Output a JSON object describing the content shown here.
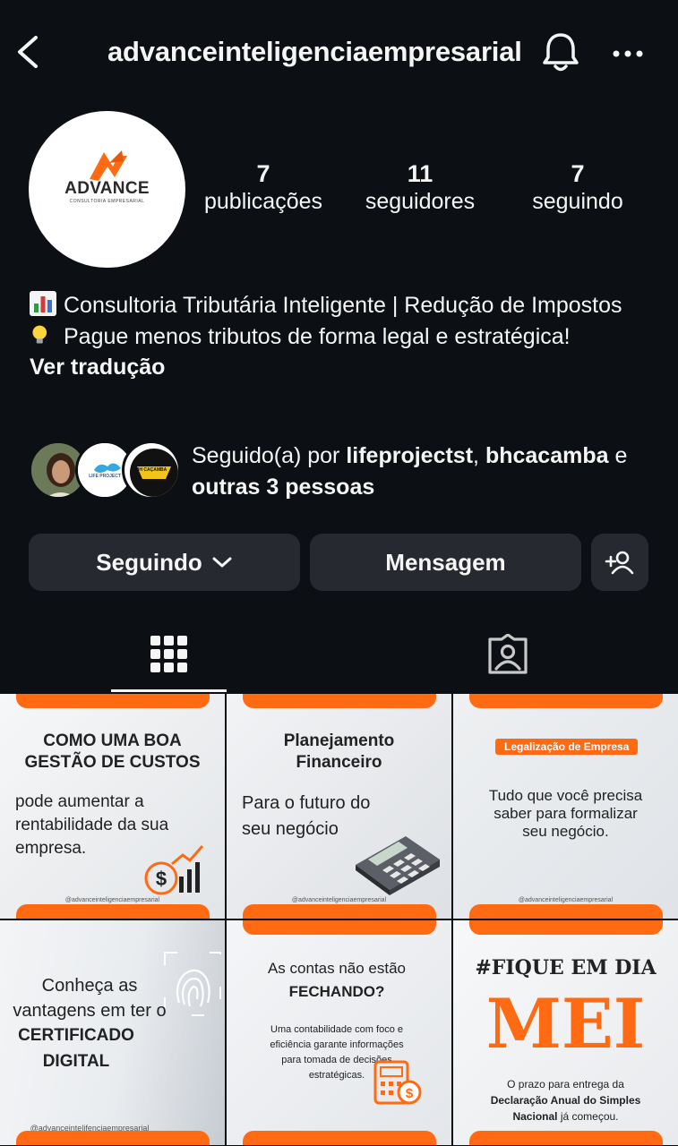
{
  "header": {
    "username": "advanceinteligenciaempresarial"
  },
  "profile": {
    "avatar_brand": "ADVANCE",
    "avatar_tagline": "CONSULTORIA EMPRESARIAL",
    "stats": [
      {
        "value": "7",
        "label": "publicações"
      },
      {
        "value": "11",
        "label": "seguidores"
      },
      {
        "value": "7",
        "label": "seguindo"
      }
    ],
    "bio_line1": "Consultoria Tributária Inteligente | Redução de Impostos",
    "bio_line2": "Pague menos tributos de forma legal e estratégica!",
    "translate_link": "Ver tradução",
    "followed_prefix": "Seguido(a) por ",
    "followed_user1": "lifeprojectst",
    "followed_sep": ", ",
    "followed_user2": "bhcacamba",
    "followed_and": " e ",
    "followed_others": "outras 3 pessoas",
    "follower_avatar2_text": "LIFE PROJECT",
    "follower_avatar3_text": "BH CAÇAMBA"
  },
  "actions": {
    "following_label": "Seguindo",
    "message_label": "Mensagem"
  },
  "posts": [
    {
      "title1": "COMO UMA BOA",
      "title2": "GESTÃO DE CUSTOS",
      "body1": "pode aumentar a",
      "body2": "rentabilidade da sua",
      "body3": "empresa.",
      "handle": "@advanceinteligenciaempresarial"
    },
    {
      "title1": "Planejamento",
      "title2": "Financeiro",
      "body1": "Para o futuro do",
      "body2": "seu negócio",
      "handle": "@advanceinteligenciaempresarial"
    },
    {
      "tag": "Legalização de Empresa",
      "body1": "Tudo que você precisa",
      "body2": "saber para formalizar",
      "body3": "seu negócio.",
      "handle": "@advanceinteligenciaempresarial"
    },
    {
      "line1": "Conheça as",
      "line2": "vantagens em ter o",
      "line3": "CERTIFICADO",
      "line4": "DIGITAL",
      "handle": "@advanceintelifenciaempresarial"
    },
    {
      "line1": "As contas não estão",
      "line2": "FECHANDO?",
      "body1": "Uma contabilidade com foco e",
      "body2": "eficiência garante informações",
      "body3": "para tomada de decisões",
      "body4": "estratégicas."
    },
    {
      "hashtag": "#FIQUE EM DIA",
      "big": "MEI",
      "body1": "O prazo para entrega da",
      "body2": "Declaração Anual do Simples",
      "body3_bold": "Nacional",
      "body3_rest": " já começou."
    }
  ],
  "colors": {
    "background": "#0c1014",
    "button": "#262a30",
    "brand_orange": "#ff6a13",
    "text": "#f5f5f5"
  },
  "icons": [
    "back-arrow-icon",
    "bell-icon",
    "more-icon",
    "chevron-down-icon",
    "add-person-icon",
    "grid-icon",
    "tagged-icon",
    "chart-emoji-icon",
    "lightbulb-emoji-icon"
  ]
}
